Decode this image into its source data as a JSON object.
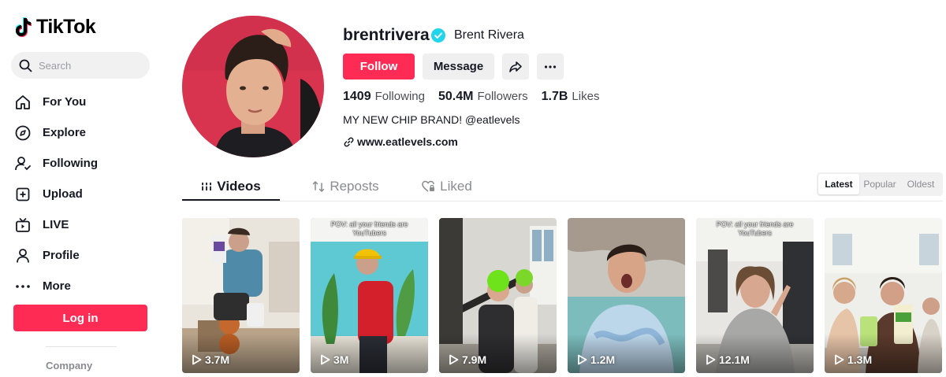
{
  "app": {
    "name": "TikTok"
  },
  "search": {
    "placeholder": "Search"
  },
  "nav": [
    {
      "label": "For You",
      "icon": "home-icon"
    },
    {
      "label": "Explore",
      "icon": "compass-icon"
    },
    {
      "label": "Following",
      "icon": "following-icon"
    },
    {
      "label": "Upload",
      "icon": "plus-square-icon"
    },
    {
      "label": "LIVE",
      "icon": "tv-icon"
    },
    {
      "label": "Profile",
      "icon": "person-icon"
    },
    {
      "label": "More",
      "icon": "more-dots-icon"
    }
  ],
  "login": {
    "label": "Log in"
  },
  "footer": {
    "company": "Company"
  },
  "profile": {
    "username": "brentrivera",
    "nickname": "Brent Rivera",
    "verified": true,
    "follow_label": "Follow",
    "message_label": "Message",
    "stats": {
      "following": {
        "value": "1409",
        "label": "Following"
      },
      "followers": {
        "value": "50.4M",
        "label": "Followers"
      },
      "likes": {
        "value": "1.7B",
        "label": "Likes"
      }
    },
    "bio": "MY NEW CHIP BRAND! @eatlevels",
    "link": "www.eatlevels.com"
  },
  "tabs": [
    {
      "label": "Videos",
      "icon": "grid-icon",
      "active": true
    },
    {
      "label": "Reposts",
      "icon": "repost-icon",
      "active": false
    },
    {
      "label": "Liked",
      "icon": "heart-icon",
      "active": false
    }
  ],
  "sort": {
    "options": [
      "Latest",
      "Popular",
      "Oldest"
    ],
    "selected": "Latest"
  },
  "videos": [
    {
      "views": "3.7M",
      "caption": ""
    },
    {
      "views": "3M",
      "caption": "POV: all your friends are YouTubers"
    },
    {
      "views": "7.9M",
      "caption": ""
    },
    {
      "views": "1.2M",
      "caption": ""
    },
    {
      "views": "12.1M",
      "caption": "POV: all your friends are YouTubers"
    },
    {
      "views": "1.3M",
      "caption": ""
    }
  ],
  "colors": {
    "accent": "#fe2c55",
    "verified": "#20d5ec",
    "text": "#161823",
    "muted": "#8a8b91"
  }
}
